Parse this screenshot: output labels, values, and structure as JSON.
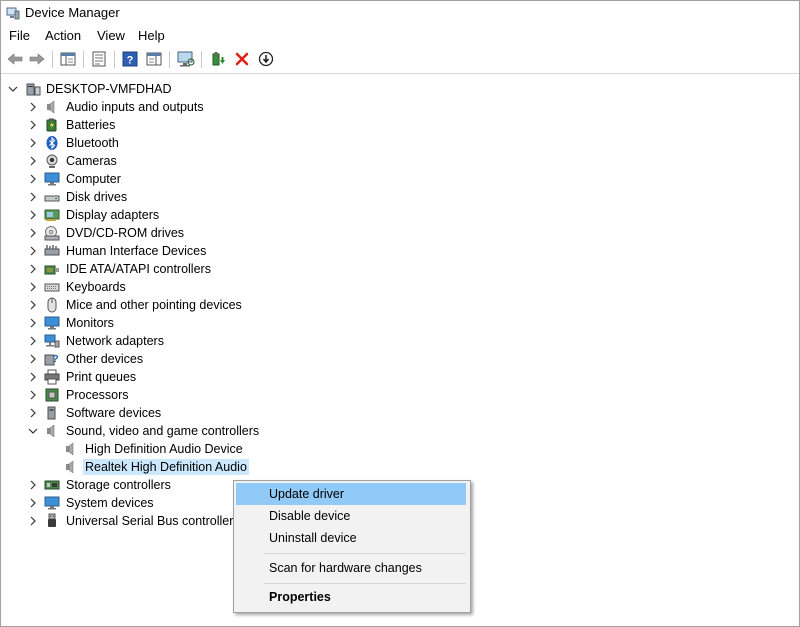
{
  "window": {
    "title": "Device Manager"
  },
  "menubar": {
    "items": [
      "File",
      "Action",
      "View",
      "Help"
    ]
  },
  "toolbar": {
    "buttons": [
      "back-icon",
      "forward-icon",
      "show-hide-console-tree-icon",
      "properties-icon",
      "help-icon",
      "action-pane-icon",
      "scan-hardware-icon",
      "update-driver-icon",
      "uninstall-icon",
      "disable-icon"
    ]
  },
  "tree": {
    "root": "DESKTOP-VMFDHAD",
    "categories": [
      "Audio inputs and outputs",
      "Batteries",
      "Bluetooth",
      "Cameras",
      "Computer",
      "Disk drives",
      "Display adapters",
      "DVD/CD-ROM drives",
      "Human Interface Devices",
      "IDE ATA/ATAPI controllers",
      "Keyboards",
      "Mice and other pointing devices",
      "Monitors",
      "Network adapters",
      "Other devices",
      "Print queues",
      "Processors",
      "Software devices",
      "Sound, video and game controllers",
      "Storage controllers",
      "System devices",
      "Universal Serial Bus controllers"
    ],
    "sound_children": [
      "High Definition Audio Device",
      "Realtek High Definition Audio"
    ],
    "selected": "Realtek High Definition Audio"
  },
  "context_menu": {
    "update_driver": "Update driver",
    "disable_device": "Disable device",
    "uninstall_device": "Uninstall device",
    "scan": "Scan for hardware changes",
    "properties": "Properties"
  },
  "colors": {
    "selection": "#cce8ff",
    "menu_highlight": "#91c9f7",
    "uninstall_red": "#e0201a"
  }
}
